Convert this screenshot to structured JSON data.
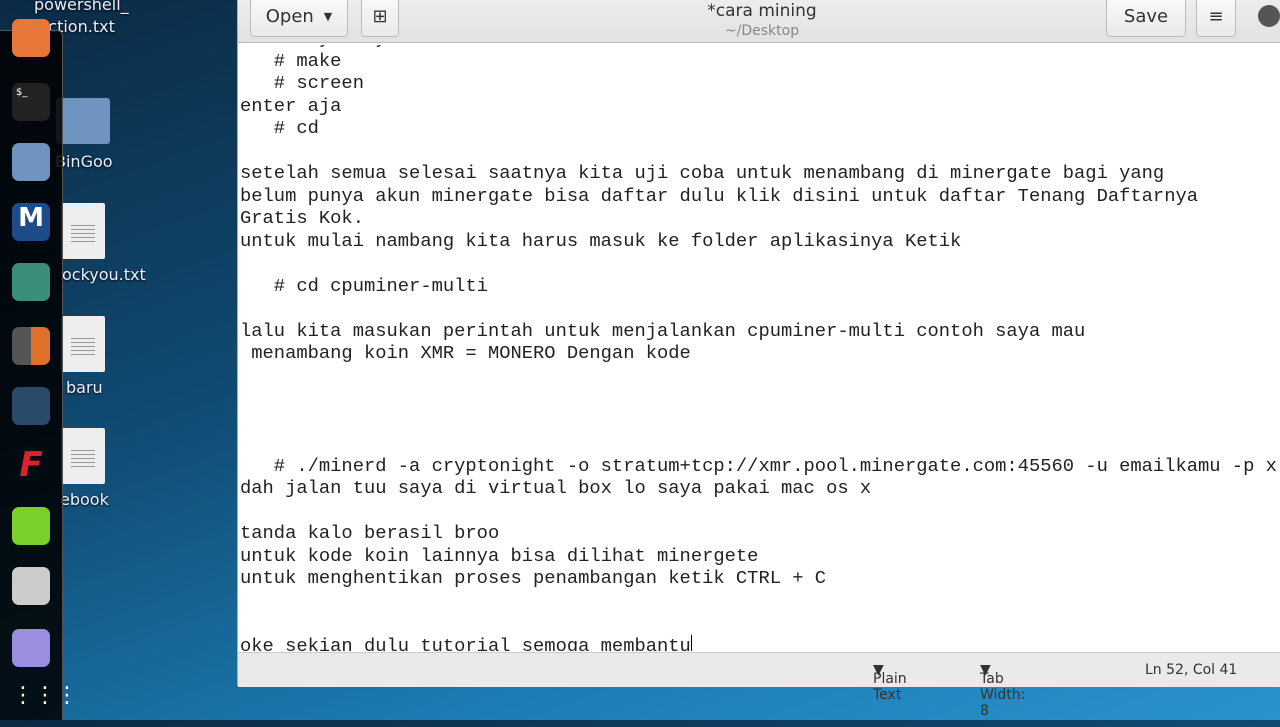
{
  "desktop": {
    "icons": [
      {
        "label": "powershell_\njection.txt",
        "type": "text"
      },
      {
        "label": "BinGoo",
        "type": "folder"
      },
      {
        "label": "ockyou.txt",
        "type": "text"
      },
      {
        "label": "baru",
        "type": "text"
      },
      {
        "label": "ebook",
        "type": "text"
      }
    ]
  },
  "dock": {
    "items": [
      "firefox-icon",
      "terminal-icon",
      "files-icon",
      "metasploit-icon",
      "armitage-icon",
      "burpsuite-icon",
      "maltego-icon",
      "faraday-icon",
      "leafpad-icon",
      "keyboard-icon",
      "gedit-icon",
      "app-grid-icon"
    ]
  },
  "editor": {
    "title": "*cara mining",
    "subtitle": "~/Desktop",
    "open_label": "Open",
    "save_label": "Save",
    "lines": [
      "   # ./y  ./y",
      "   # make",
      "   # screen",
      "enter aja",
      "   # cd",
      "",
      "setelah semua selesai saatnya kita uji coba untuk menambang di minergate bagi yang",
      "belum punya akun minergate bisa daftar dulu klik disini untuk daftar Tenang Daftarnya",
      "Gratis Kok.",
      "untuk mulai nambang kita harus masuk ke folder aplikasinya Ketik",
      "",
      "   # cd cpuminer-multi",
      "",
      "lalu kita masukan perintah untuk menjalankan cpuminer-multi contoh saya mau",
      " menambang koin XMR = MONERO Dengan kode",
      "",
      "",
      "",
      "",
      "   # ./minerd -a cryptonight -o stratum+tcp://xmr.pool.minergate.com:45560 -u emailkamu -p x",
      "dah jalan tuu saya di virtual box lo saya pakai mac os x",
      "",
      "tanda kalo berasil broo",
      "untuk kode koin lainnya bisa dilihat minergete",
      "untuk menghentikan proses penambangan ketik CTRL + C",
      "",
      "",
      "oke sekian dulu tutorial semoga membantu"
    ],
    "status": {
      "language": "Plain Text",
      "tab_width": "Tab Width: 8",
      "position": "Ln 52, Col 41"
    }
  }
}
